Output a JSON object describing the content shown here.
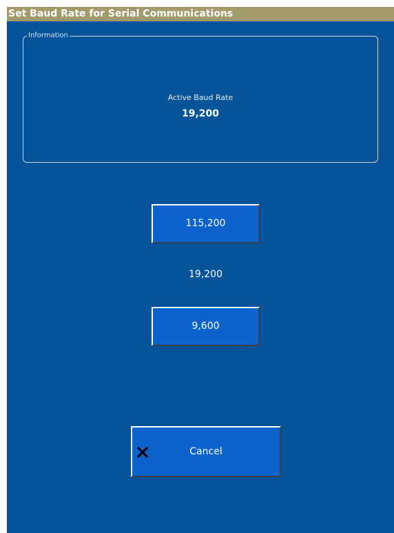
{
  "title": "Set Baud Rate for Serial Communications",
  "information": {
    "legend": "Information",
    "label": "Active Baud Rate",
    "value": "19,200"
  },
  "rates": {
    "higher": "115,200",
    "current": "19,200",
    "lower": "9,600"
  },
  "cancel": {
    "label": "Cancel",
    "icon": "close-x-icon"
  },
  "colors": {
    "background": "#05549a",
    "titlebar": "#a29a6a",
    "button": "#0d63cc"
  }
}
